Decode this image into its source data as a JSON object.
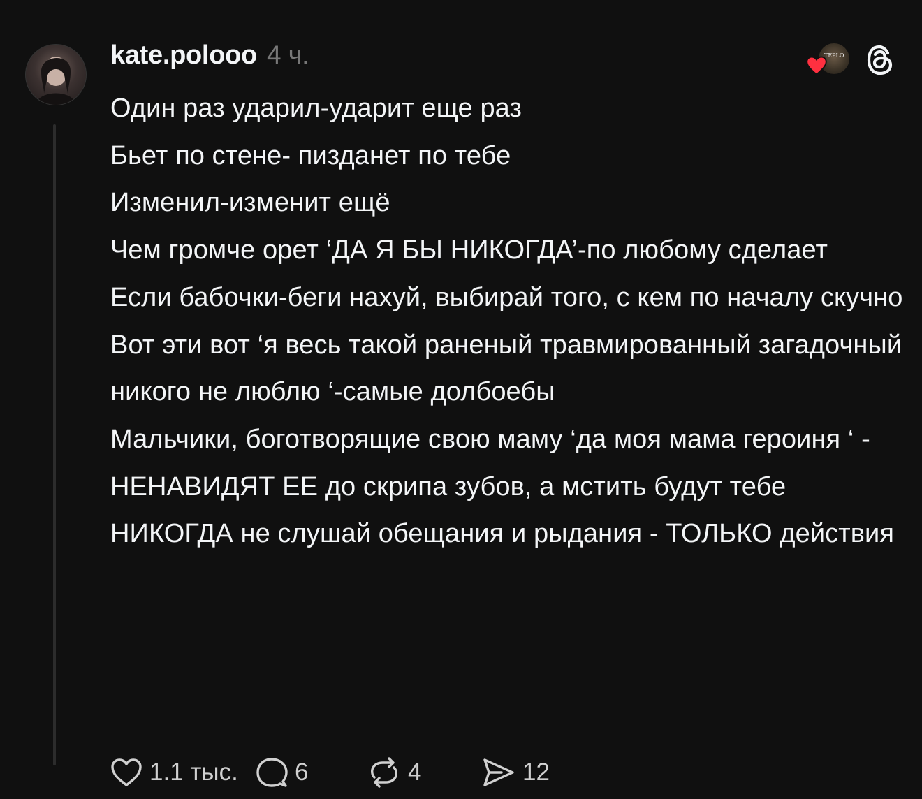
{
  "post": {
    "username": "kate.polooo",
    "time": "4 ч.",
    "lines": [
      "Один раз ударил-ударит еще раз",
      "Бьет по стене- пизданет по тебе",
      "Изменил-изменит ещё",
      "Чем громче орет ‘ДА Я БЫ НИКОГДА’-по любому сделает",
      "Если бабочки-беги нахуй, выбирай того, с кем по началу скучно",
      "Вот эти вот ‘я весь такой раненый травмированный загадочный никого не люблю ‘-самые долбоебы",
      "Мальчики, боготворящие свою маму ‘да моя мама героиня ‘ -НЕНАВИДЯТ ЕЕ до скрипа зубов, а мстить будут тебе",
      "НИКОГДА не слушай обещания и рыдания - ТОЛЬКО действия"
    ]
  },
  "liker": {
    "avatar_text": "TEPLO"
  },
  "actions": {
    "likes": "1.1 тыс.",
    "replies": "6",
    "reposts": "4",
    "shares": "12"
  },
  "icons": {
    "like": "heart-outline-icon",
    "reply": "speech-bubble-icon",
    "repost": "repost-arrows-icon",
    "share": "paper-plane-icon",
    "logo": "threads-logo-icon"
  },
  "colors": {
    "background": "#101010",
    "text": "#f3f5f7",
    "muted": "#777777",
    "heart": "#ff3040"
  }
}
